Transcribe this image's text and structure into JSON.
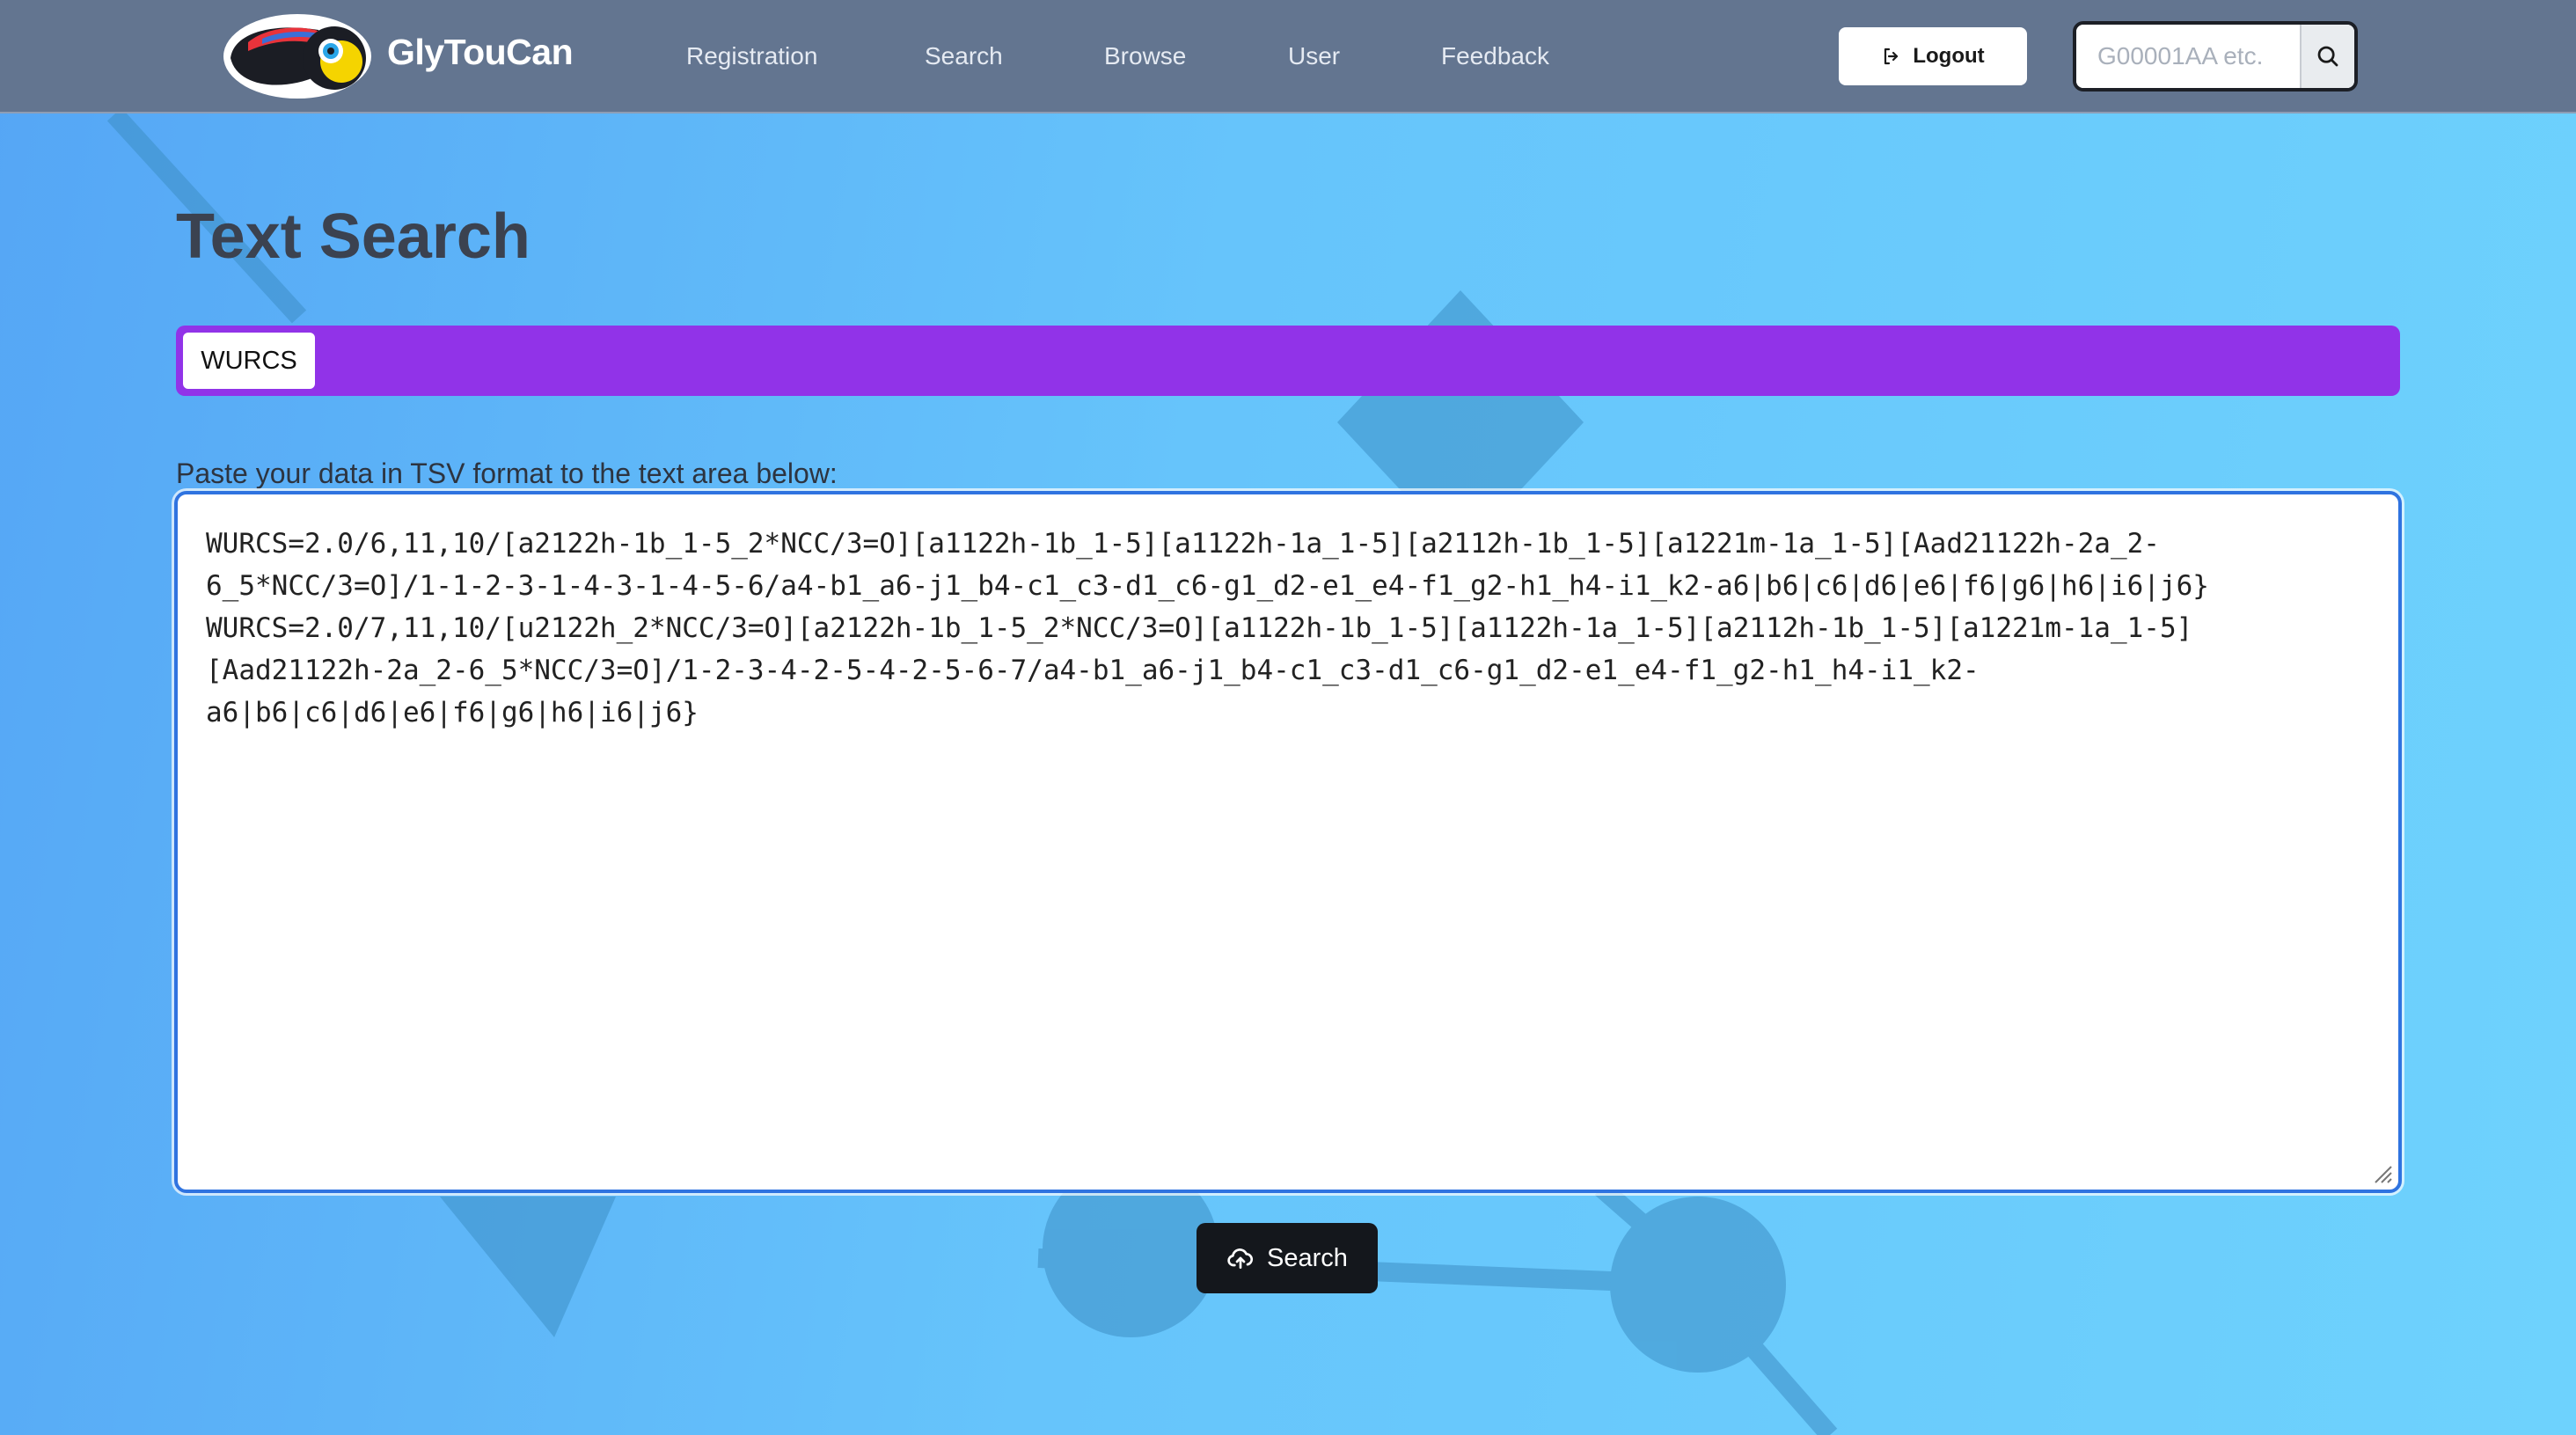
{
  "app": {
    "brand": "GlyTouCan"
  },
  "nav": {
    "items": [
      {
        "label": "Registration"
      },
      {
        "label": "Search"
      },
      {
        "label": "Browse"
      },
      {
        "label": "User"
      },
      {
        "label": "Feedback"
      }
    ],
    "logout_label": "Logout",
    "search_placeholder": "G00001AA etc."
  },
  "main": {
    "title": "Text Search",
    "tabs": [
      {
        "label": "WURCS",
        "active": true
      }
    ],
    "instructions": "Paste your data in TSV format to the text area below:",
    "textarea_value": "WURCS=2.0/6,11,10/[a2122h-1b_1-5_2*NCC/3=O][a1122h-1b_1-5][a1122h-1a_1-5][a2112h-1b_1-5][a1221m-1a_1-5][Aad21122h-2a_2-6_5*NCC/3=O]/1-1-2-3-1-4-3-1-4-5-6/a4-b1_a6-j1_b4-c1_c3-d1_c6-g1_d2-e1_e4-f1_g2-h1_h4-i1_k2-a6|b6|c6|d6|e6|f6|g6|h6|i6|j6}\nWURCS=2.0/7,11,10/[u2122h_2*NCC/3=O][a2122h-1b_1-5_2*NCC/3=O][a1122h-1b_1-5][a1122h-1a_1-5][a2112h-1b_1-5][a1221m-1a_1-5][Aad21122h-2a_2-6_5*NCC/3=O]/1-2-3-4-2-5-4-2-5-6-7/a4-b1_a6-j1_b4-c1_c3-d1_c6-g1_d2-e1_e4-f1_g2-h1_h4-i1_k2-a6|b6|c6|d6|e6|f6|g6|h6|i6|j6}",
    "submit_label": "Search"
  },
  "colors": {
    "navbar": "#637590",
    "tab_bar": "#9133e8",
    "textarea_border": "#2f73e0",
    "submit_button": "#14171c"
  }
}
